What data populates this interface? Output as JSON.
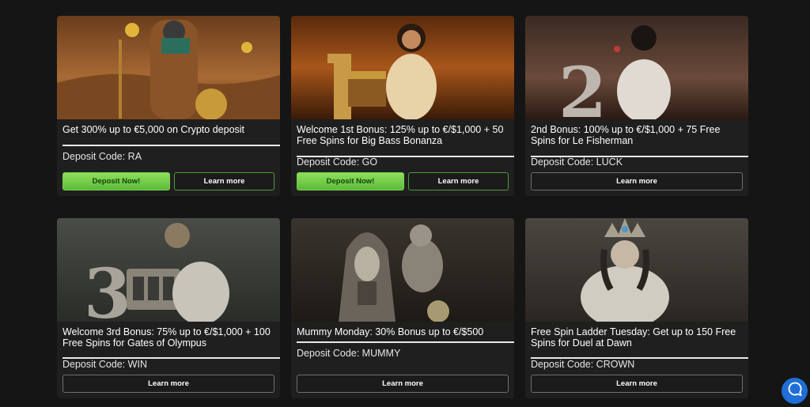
{
  "cards": [
    {
      "title": "Get 300% up to €5,000 on Crypto deposit",
      "code": "Deposit Code: RA",
      "deposit_label": "Deposit Now!",
      "learn_label": "Learn more",
      "art": "horus-god-desert"
    },
    {
      "title": "Welcome 1st Bonus: 125% up to €/$1,000 + 50 Free Spins for Big Bass Bonanza",
      "code": "Deposit Code: GO",
      "deposit_label": "Deposit Now!",
      "learn_label": "Learn more",
      "art": "cleopatra-treasure-number-1"
    },
    {
      "title": "2nd Bonus: 100% up to €/$1,000 + 75 Free Spins for Le Fisherman",
      "code": "Deposit Code: LUCK",
      "learn_label": "Learn more",
      "art": "bastet-number-2"
    },
    {
      "title": "Welcome 3rd Bonus: 75% up to €/$1,000 + 100 Free Spins for Gates of Olympus",
      "code": "Deposit Code: WIN",
      "learn_label": "Learn more",
      "art": "lioness-slot-number-3"
    },
    {
      "title": "Mummy Monday: 30% Bonus up to €/$500",
      "code": "Deposit Code: MUMMY",
      "learn_label": "Learn more",
      "art": "pharaoh-mummy"
    },
    {
      "title": "Free Spin Ladder Tuesday: Get up to 150 Free Spins for Duel at Dawn",
      "code": "Deposit Code: CROWN",
      "learn_label": "Learn more",
      "art": "crowned-queen"
    }
  ],
  "chat_widget": {
    "icon": "chat-bubble-icon"
  }
}
